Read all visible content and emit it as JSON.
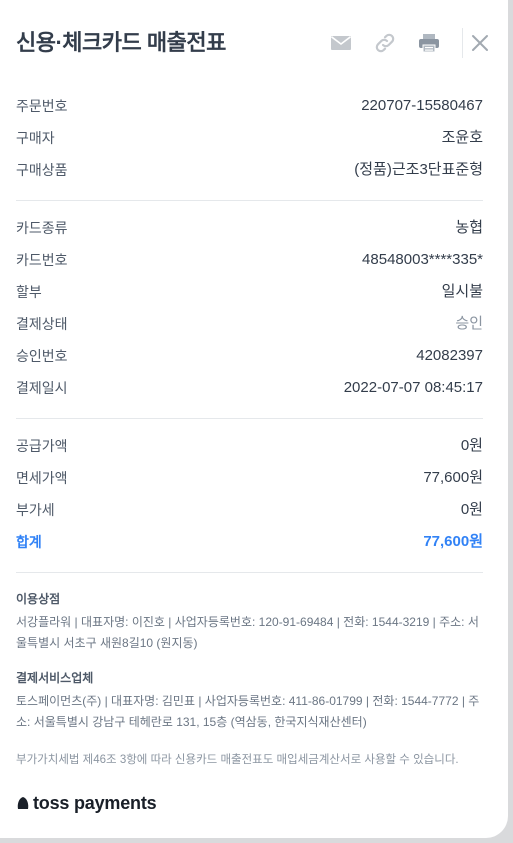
{
  "header": {
    "title": "신용·체크카드 매출전표",
    "icons": [
      "mail-icon",
      "link-icon",
      "print-icon",
      "close-icon"
    ]
  },
  "order": [
    {
      "label": "주문번호",
      "value": "220707-15580467"
    },
    {
      "label": "구매자",
      "value": "조윤호"
    },
    {
      "label": "구매상품",
      "value": "(정품)근조3단표준형"
    }
  ],
  "card": [
    {
      "label": "카드종류",
      "value": "농협"
    },
    {
      "label": "카드번호",
      "value": "48548003****335*"
    },
    {
      "label": "할부",
      "value": "일시불"
    },
    {
      "label": "결제상태",
      "value": "승인"
    },
    {
      "label": "승인번호",
      "value": "42082397"
    },
    {
      "label": "결제일시",
      "value": "2022-07-07 08:45:17"
    }
  ],
  "amount": [
    {
      "label": "공급가액",
      "value": "0원"
    },
    {
      "label": "면세가액",
      "value": "77,600원"
    },
    {
      "label": "부가세",
      "value": "0원"
    }
  ],
  "total": {
    "label": "합계",
    "value": "77,600원"
  },
  "merchant": {
    "heading": "이용상점",
    "text": "서강플라워 | 대표자명: 이진호 | 사업자등록번호: 120-91-69484 | 전화: 1544-3219 | 주소: 서울특별시 서초구 새원8길10 (원지동)"
  },
  "pg": {
    "heading": "결제서비스업체",
    "text": "토스페이먼츠(주) | 대표자명: 김민표 | 사업자등록번호: 411-86-01799 | 전화: 1544-7772 | 주소: 서울특별시 강남구 테헤란로 131, 15층 (역삼동, 한국지식재산센터)"
  },
  "notice": "부가가치세법 제46조 3항에 따라 신용카드 매출전표도 매입세금계산서로 사용할 수 있습니다.",
  "logo": {
    "text": "toss payments"
  },
  "colors": {
    "accent": "#3182f6",
    "text": "#333d4b",
    "muted": "#8b95a1",
    "divider": "#e5e8eb"
  }
}
